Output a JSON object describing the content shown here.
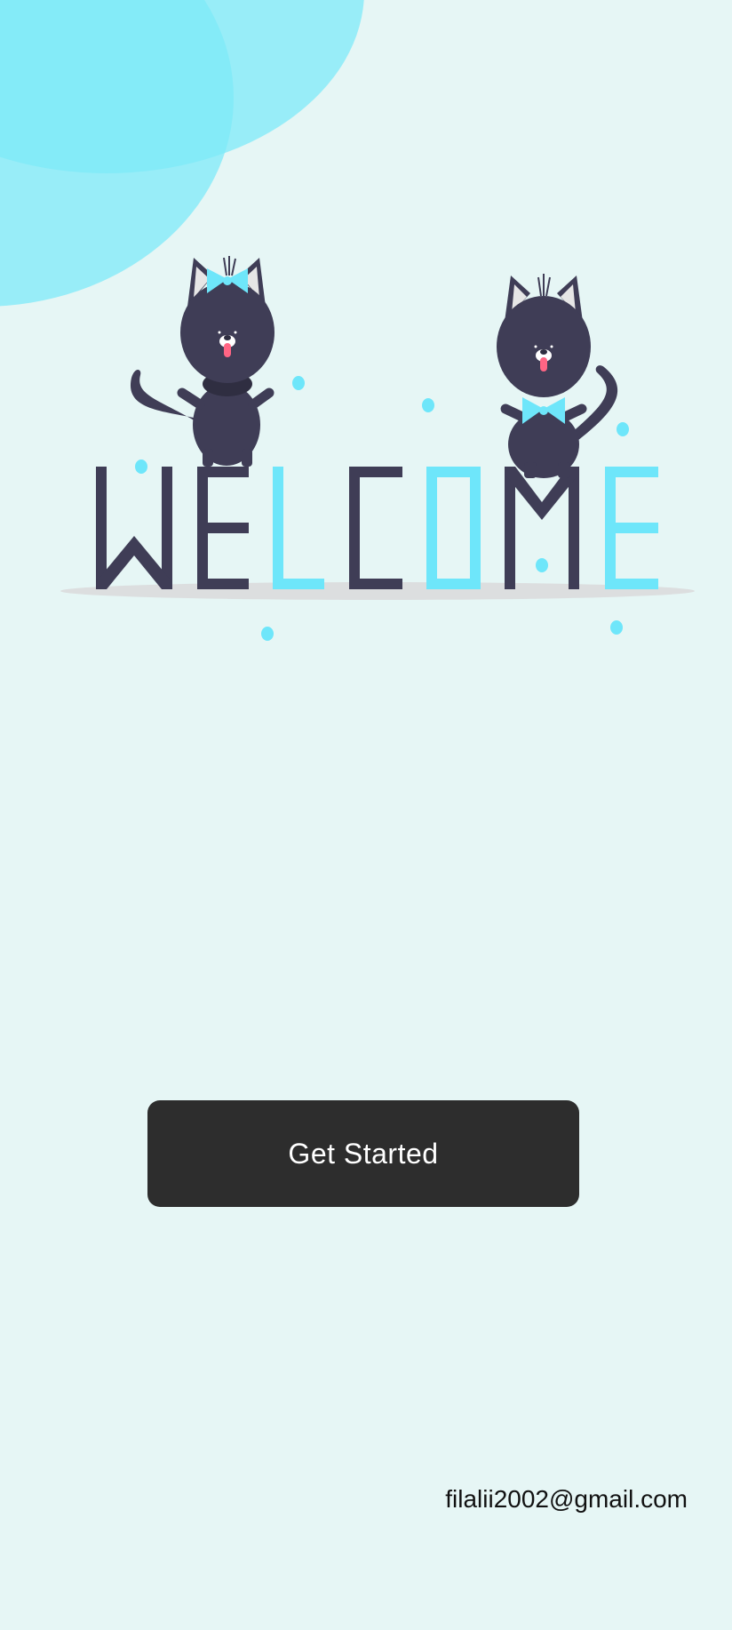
{
  "colors": {
    "background": "#e6f6f5",
    "accent": "#6ee6fa",
    "dark": "#3f3d56",
    "button": "#2d2d2d"
  },
  "hero": {
    "illustration": "two-cats-welcome",
    "letters": [
      {
        "char": "W",
        "color": "dark"
      },
      {
        "char": "E",
        "color": "dark"
      },
      {
        "char": "L",
        "color": "accent"
      },
      {
        "char": "C",
        "color": "dark"
      },
      {
        "char": "O",
        "color": "accent"
      },
      {
        "char": "M",
        "color": "dark"
      },
      {
        "char": "E",
        "color": "accent"
      }
    ]
  },
  "actions": {
    "get_started_label": "Get Started"
  },
  "footer": {
    "email": "filalii2002@gmail.com"
  }
}
